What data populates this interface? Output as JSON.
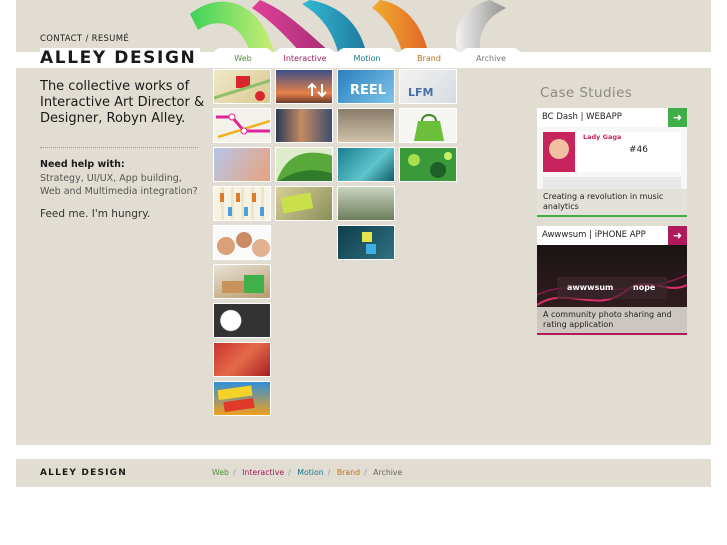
{
  "header": {
    "top_links": [
      "CONTACT",
      "RESUMÉ"
    ],
    "logo": "ALLEY DESIGN",
    "tabs": [
      {
        "label": "Web",
        "color": "#4f8f3c"
      },
      {
        "label": "Interactive",
        "color": "#9b1c5a"
      },
      {
        "label": "Motion",
        "color": "#14788a"
      },
      {
        "label": "Brand",
        "color": "#b2701e"
      },
      {
        "label": "Archive",
        "color": "#777777"
      }
    ]
  },
  "intro": {
    "tagline": "The collective works of Interactive Art Director & Designer, Robyn Alley.",
    "help_heading": "Need help with:",
    "help_text": "Strategy, UI/UX, App building, Web and Multimedia integration?",
    "feed": "Feed me. I'm hungry."
  },
  "portfolio": {
    "web": [
      "map-collage",
      "metro-line-graphic",
      "illustrated-people",
      "figure-grid",
      "portrait-circles",
      "green-packaging",
      "poster-faces",
      "red-typography",
      "factory-tour-poster"
    ],
    "interactive": [
      "sunset-video",
      "face-closeup",
      "green-leaf",
      "business-card"
    ],
    "motion": [
      "reel-title",
      "house-interior",
      "teal-texture",
      "tree-photo",
      "abc-blocks"
    ],
    "brand": [
      "typography-cards",
      "green-tote",
      "green-pattern"
    ]
  },
  "case_studies": {
    "title": "Case Studies",
    "items": [
      {
        "title": "BC Dash | WEBAPP",
        "accent": "#3fae49",
        "caption": "Creating a revolution in music analytics",
        "screen_labels": [
          "Lady Gaga",
          "#46"
        ]
      },
      {
        "title": "Awwwsum | iPHONE APP",
        "accent": "#b0195a",
        "caption": "A community photo sharing and rating application",
        "screen_labels": [
          "awwwsum",
          "nope"
        ]
      }
    ]
  },
  "footer": {
    "logo": "ALLEY DESIGN",
    "nav": [
      {
        "label": "Web",
        "color": "#4f8f3c"
      },
      {
        "label": "Interactive",
        "color": "#9b1c5a"
      },
      {
        "label": "Motion",
        "color": "#14788a"
      },
      {
        "label": "Brand",
        "color": "#b2701e"
      },
      {
        "label": "Archive",
        "color": "#666666"
      }
    ]
  }
}
